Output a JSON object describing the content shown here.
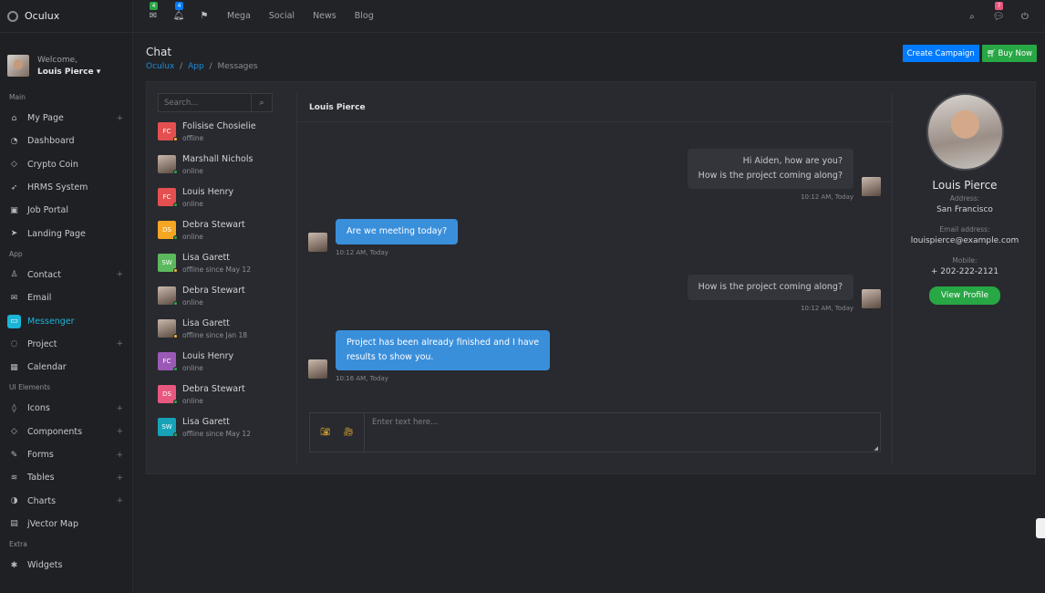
{
  "brand": "Oculux",
  "user": {
    "welcome": "Welcome,",
    "name": "Louis Pierce ▾"
  },
  "sidebar": {
    "sections": [
      {
        "title": "Main",
        "items": [
          {
            "label": "My Page",
            "icon": "home-icon",
            "plus": true
          },
          {
            "label": "Dashboard",
            "icon": "speedometer-icon",
            "plus": false
          },
          {
            "label": "Crypto Coin",
            "icon": "diamond-icon",
            "plus": false
          },
          {
            "label": "HRMS System",
            "icon": "rocket-icon",
            "plus": false
          },
          {
            "label": "Job Portal",
            "icon": "briefcase-icon",
            "plus": false
          },
          {
            "label": "Landing Page",
            "icon": "cursor-icon",
            "plus": false
          }
        ]
      },
      {
        "title": "App",
        "items": [
          {
            "label": "Contact",
            "icon": "user-icon",
            "plus": true
          },
          {
            "label": "Email",
            "icon": "envelope-icon",
            "plus": false
          },
          {
            "label": "Messenger",
            "icon": "chat-icon",
            "plus": false,
            "active": true
          },
          {
            "label": "Project",
            "icon": "chat-bubbles-icon",
            "plus": true
          },
          {
            "label": "Calendar",
            "icon": "calendar-icon",
            "plus": false
          }
        ]
      },
      {
        "title": "UI Elements",
        "items": [
          {
            "label": "Icons",
            "icon": "tag-icon",
            "plus": true
          },
          {
            "label": "Components",
            "icon": "diamond-icon",
            "plus": true
          },
          {
            "label": "Forms",
            "icon": "pencil-icon",
            "plus": true
          },
          {
            "label": "Tables",
            "icon": "layers-icon",
            "plus": true
          },
          {
            "label": "Charts",
            "icon": "pie-chart-icon",
            "plus": true
          },
          {
            "label": "jVector Map",
            "icon": "map-icon",
            "plus": false
          }
        ]
      },
      {
        "title": "Extra",
        "items": [
          {
            "label": "Widgets",
            "icon": "puzzle-icon",
            "plus": false
          }
        ]
      }
    ]
  },
  "topbar": {
    "mail_badge": "4",
    "bell_badge": "4",
    "links": [
      "Mega",
      "Social",
      "News",
      "Blog"
    ],
    "chat_badge": "7"
  },
  "page": {
    "title": "Chat",
    "crumbs": {
      "c1": "Oculux",
      "sep1": "/",
      "c2": "App",
      "sep2": "/",
      "c3": "Messages"
    }
  },
  "buttons": {
    "create": "Create Campaign",
    "buy": "Buy Now"
  },
  "search": {
    "placeholder": "Search..."
  },
  "contacts": [
    {
      "initials": "FC",
      "name": "Folisise Chosielie",
      "status": "offline",
      "color": "#e3504f",
      "dot": "#f2b533",
      "photo": false
    },
    {
      "initials": "",
      "name": "Marshall Nichols",
      "status": "online",
      "color": "",
      "dot": "#28a745",
      "photo": true
    },
    {
      "initials": "FC",
      "name": "Louis Henry",
      "status": "online",
      "color": "#e3504f",
      "dot": "#28a745",
      "photo": false
    },
    {
      "initials": "DS",
      "name": "Debra Stewart",
      "status": "online",
      "color": "#f5a623",
      "dot": "#28a745",
      "photo": false
    },
    {
      "initials": "SW",
      "name": "Lisa Garett",
      "status": "offline since May 12",
      "color": "#5cb85c",
      "dot": "#f2b533",
      "photo": false
    },
    {
      "initials": "",
      "name": "Debra Stewart",
      "status": "online",
      "color": "",
      "dot": "#28a745",
      "photo": true
    },
    {
      "initials": "",
      "name": "Lisa Garett",
      "status": "offline since Jan 18",
      "color": "",
      "dot": "#f2b533",
      "photo": true
    },
    {
      "initials": "FC",
      "name": "Louis Henry",
      "status": "online",
      "color": "#9b59b6",
      "dot": "#28a745",
      "photo": false
    },
    {
      "initials": "DS",
      "name": "Debra Stewart",
      "status": "online",
      "color": "#e8577e",
      "dot": "#28a745",
      "photo": false
    },
    {
      "initials": "SW",
      "name": "Lisa Garett",
      "status": "offline since May 12",
      "color": "#17a2b8",
      "dot": "#28a745",
      "photo": false
    }
  ],
  "chat": {
    "name": "Louis Pierce",
    "messages": [
      {
        "dir": "in",
        "lines": [
          "Hi Aiden, how are you?",
          "How is the project coming along?"
        ],
        "time": "10:12 AM, Today"
      },
      {
        "dir": "out",
        "lines": [
          "Are we meeting today?"
        ],
        "time": "10:12 AM, Today"
      },
      {
        "dir": "in",
        "lines": [
          "How is the project coming along?"
        ],
        "time": "10:12 AM, Today"
      },
      {
        "dir": "out",
        "lines": [
          "Project has been already finished and I have",
          "results to show you."
        ],
        "time": "10:16 AM, Today"
      }
    ],
    "input_placeholder": "Enter text here..."
  },
  "profile": {
    "name": "Louis Pierce",
    "address_label": "Address:",
    "address": "San Francisco",
    "email_label": "Email address:",
    "email": "louispierce@example.com",
    "mobile_label": "Mobile:",
    "mobile": "+ 202-222-2121",
    "button": "View Profile"
  },
  "colors": {
    "accent": "#1ab5d6",
    "primary": "#007bff",
    "success": "#28a745",
    "bubble": "#3a8fdb"
  }
}
